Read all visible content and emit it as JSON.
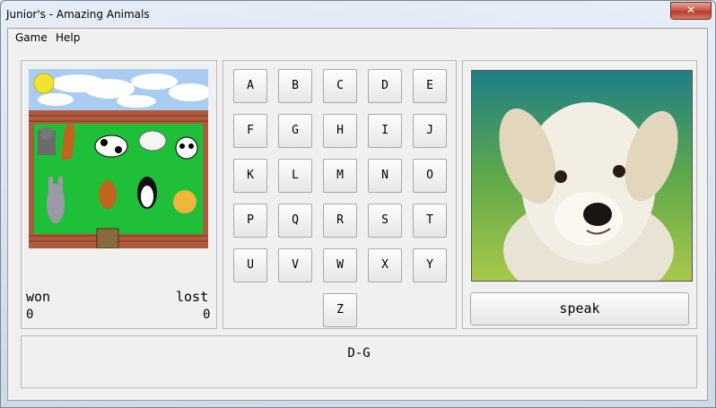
{
  "window": {
    "title": "Junior's - Amazing Animals",
    "close_glyph": "✕"
  },
  "menu": {
    "items": [
      "Game",
      "Help"
    ]
  },
  "letters": [
    "A",
    "B",
    "C",
    "D",
    "E",
    "F",
    "G",
    "H",
    "I",
    "J",
    "K",
    "L",
    "M",
    "N",
    "O",
    "P",
    "Q",
    "R",
    "S",
    "T",
    "U",
    "V",
    "W",
    "X",
    "Y",
    "Z"
  ],
  "score": {
    "won_label": "won",
    "won_value": "0",
    "lost_label": "lost",
    "lost_value": "0"
  },
  "speak_label": "speak",
  "status_text": "D-G",
  "colors": {
    "field_green": "#1fbf3a",
    "brick": "#a0523a",
    "sky": "#a9cdf2"
  }
}
